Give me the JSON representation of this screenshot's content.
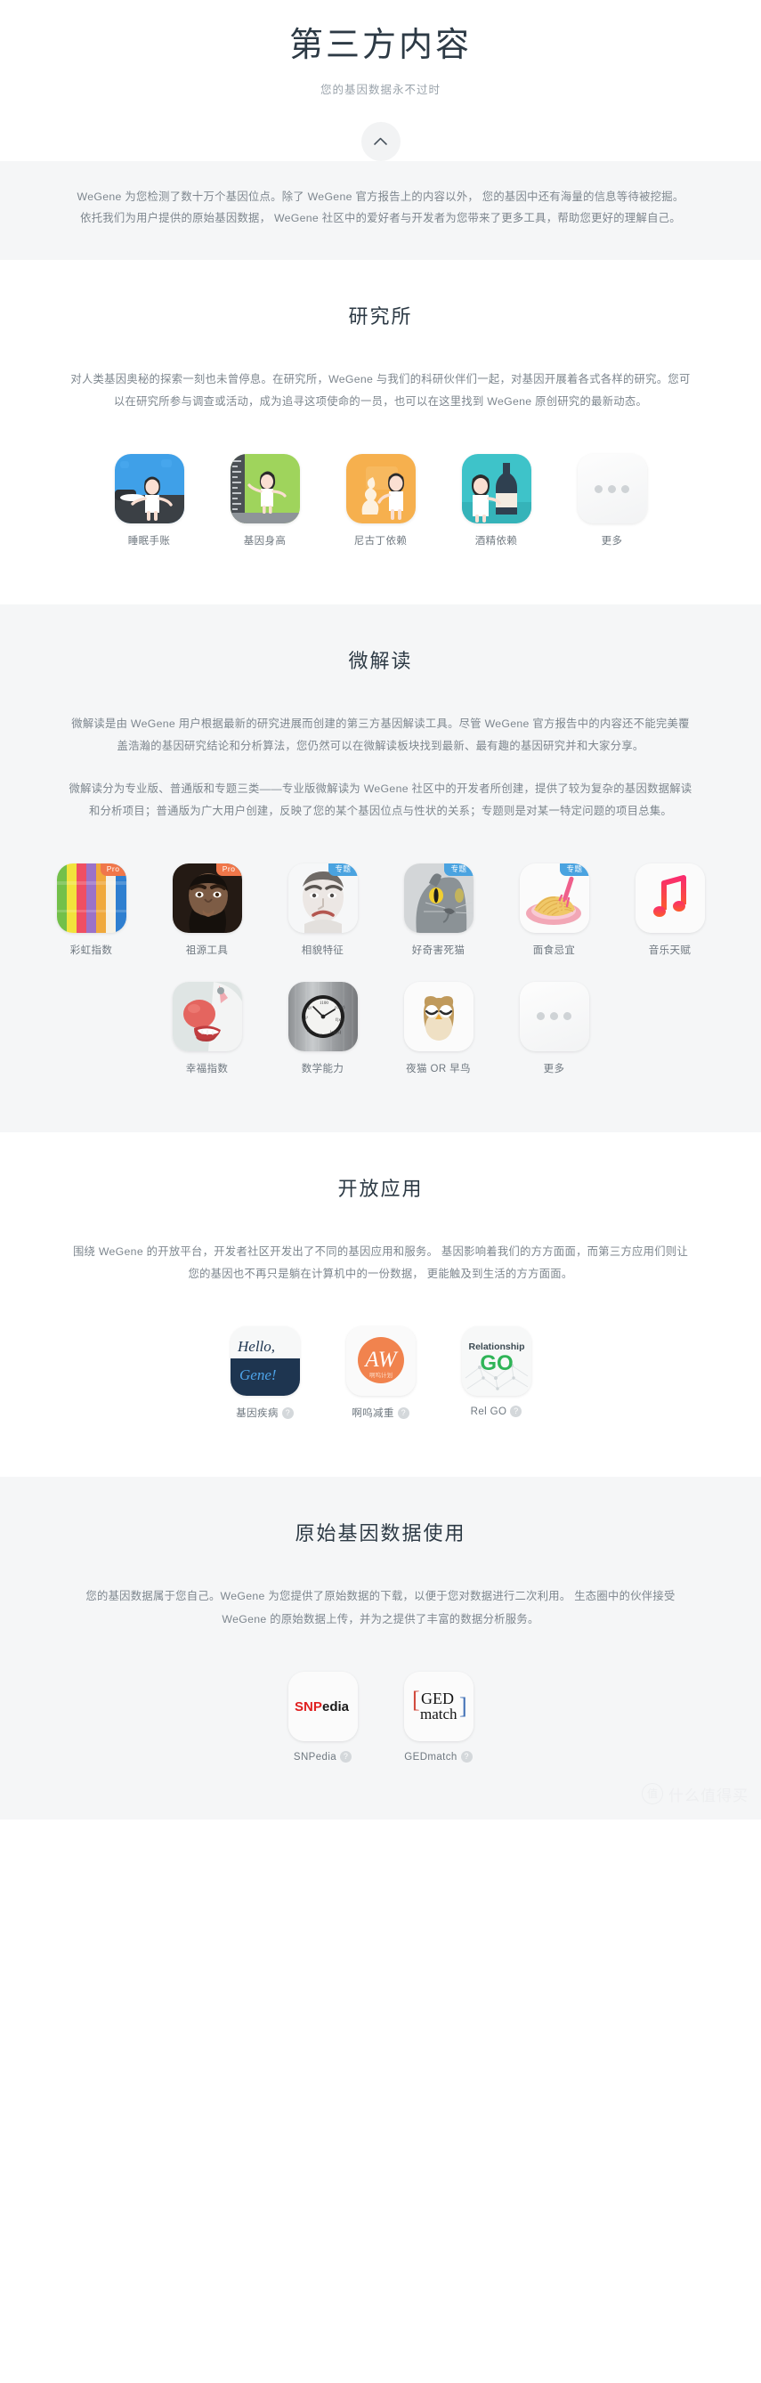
{
  "hero": {
    "title": "第三方内容",
    "subtitle": "您的基因数据永不过时",
    "collapse_icon": "chevron-up-icon"
  },
  "intro": {
    "paragraph": "WeGene 为您检测了数十万个基因位点。除了 WeGene 官方报告上的内容以外， 您的基因中还有海量的信息等待被挖掘。依托我们为用户提供的原始基因数据， WeGene 社区中的爱好者与开发者为您带来了更多工具，帮助您更好的理解自己。"
  },
  "sections": [
    {
      "id": "institute",
      "title": "研究所",
      "desc1": "对人类基因奥秘的探索一刻也未曾停息。在研究所，WeGene 与我们的科研伙伴们一起，对基因开展着各式各样的研究。您可以在研究所参与调查或活动，成为追寻这项使命的一员，也可以在这里找到 WeGene 原创研究的最新动态。",
      "desc2": "",
      "apps": [
        {
          "label": "睡眠手账",
          "icon": "sleep-journal-icon",
          "badge": ""
        },
        {
          "label": "基因身高",
          "icon": "gene-height-icon",
          "badge": ""
        },
        {
          "label": "尼古丁依赖",
          "icon": "nicotine-dependence-icon",
          "badge": ""
        },
        {
          "label": "酒精依赖",
          "icon": "alcohol-dependence-icon",
          "badge": ""
        },
        {
          "label": "更多",
          "icon": "more-dots-icon",
          "badge": ""
        }
      ]
    },
    {
      "id": "micro-reading",
      "title": "微解读",
      "desc1": "微解读是由 WeGene 用户根据最新的研究进展而创建的第三方基因解读工具。尽管 WeGene 官方报告中的内容还不能完美覆盖浩瀚的基因研究结论和分析算法，您仍然可以在微解读板块找到最新、最有趣的基因研究并和大家分享。",
      "desc2": "微解读分为专业版、普通版和专题三类——专业版微解读为 WeGene 社区中的开发者所创建，提供了较为复杂的基因数据解读和分析项目；普通版为广大用户创建，反映了您的某个基因位点与性状的关系；专题则是对某一特定问题的项目总集。",
      "apps": [
        {
          "label": "彩虹指数",
          "icon": "rainbow-index-icon",
          "badge": "Pro"
        },
        {
          "label": "祖源工具",
          "icon": "ancestry-tool-icon",
          "badge": "Pro"
        },
        {
          "label": "相貌特征",
          "icon": "facial-features-icon",
          "badge": "专题"
        },
        {
          "label": "好奇害死猫",
          "icon": "curious-cat-icon",
          "badge": "专题"
        },
        {
          "label": "面食忌宜",
          "icon": "pasta-diet-icon",
          "badge": "专题"
        },
        {
          "label": "音乐天赋",
          "icon": "music-talent-icon",
          "badge": ""
        },
        {
          "label": "幸福指数",
          "icon": "happiness-index-icon",
          "badge": ""
        },
        {
          "label": "数学能力",
          "icon": "math-ability-icon",
          "badge": ""
        },
        {
          "label": "夜猫 OR 早鸟",
          "icon": "owl-chronotype-icon",
          "badge": ""
        },
        {
          "label": "更多",
          "icon": "more-dots-icon",
          "badge": ""
        }
      ]
    },
    {
      "id": "open-apps",
      "title": "开放应用",
      "desc1": "围绕 WeGene 的开放平台，开发者社区开发出了不同的基因应用和服务。 基因影响着我们的方方面面，而第三方应用们则让您的基因也不再只是躺在计算机中的一份数据， 更能触及到生活的方方面面。",
      "desc2": "",
      "apps": [
        {
          "label": "基因疾病",
          "icon": "hello-gene-icon",
          "badge": "",
          "help": "?"
        },
        {
          "label": "啊呜减重",
          "icon": "aw-weightloss-icon",
          "badge": "",
          "help": "?"
        },
        {
          "label": "Rel GO",
          "icon": "relationship-go-icon",
          "badge": "",
          "help": "?"
        }
      ]
    },
    {
      "id": "raw-data",
      "title": "原始基因数据使用",
      "desc1": "您的基因数据属于您自己。WeGene 为您提供了原始数据的下载，以便于您对数据进行二次利用。 生态圈中的伙伴接受 WeGene 的原始数据上传，并为之提供了丰富的数据分析服务。",
      "desc2": "",
      "apps": [
        {
          "label": "SNPedia",
          "icon": "snpedia-icon",
          "badge": "",
          "help": "?"
        },
        {
          "label": "GEDmatch",
          "icon": "gedmatch-icon",
          "badge": "",
          "help": "?"
        }
      ]
    }
  ],
  "watermark": {
    "mark": "值",
    "text": "什么值得买"
  },
  "colors": {
    "page_bg": "#ffffff",
    "band_bg": "#f5f6f7",
    "heading": "#2d3a45",
    "body_text": "#7d868e",
    "label_text": "#6f7880",
    "badge_pro": "#f0774a",
    "badge_topic": "#4aa3e0"
  }
}
